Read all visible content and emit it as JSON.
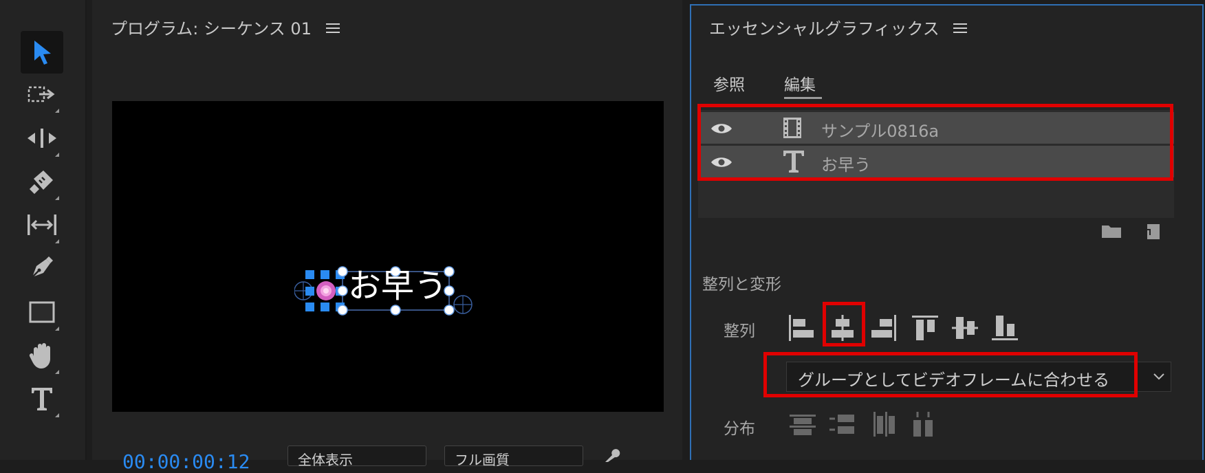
{
  "program": {
    "title": "プログラム: シーケンス 01",
    "overlay_text": "お早う",
    "timecode": "00:00:00:12",
    "zoom_select": "全体表示",
    "quality_select": "フル画質"
  },
  "essential_graphics": {
    "title": "エッセンシャルグラフィックス",
    "tabs": [
      "参照",
      "編集"
    ],
    "active_tab": "編集",
    "layers": [
      {
        "name": "サンプル0816a",
        "type": "video"
      },
      {
        "name": "お早う",
        "type": "text"
      }
    ],
    "section_title": "整列と変形",
    "align_label": "整列",
    "align_target": "グループとしてビデオフレームに合わせる",
    "distribute_label": "分布"
  },
  "colors": {
    "accent": "#2a8bf2",
    "highlight": "#e00000",
    "panel_border": "#2f6fb5"
  },
  "icons": {
    "tools": [
      "selection-tool-icon",
      "track-select-icon",
      "ripple-edit-icon",
      "razor-icon",
      "slip-icon",
      "pen-icon",
      "rectangle-icon",
      "hand-icon",
      "type-tool-icon"
    ]
  }
}
